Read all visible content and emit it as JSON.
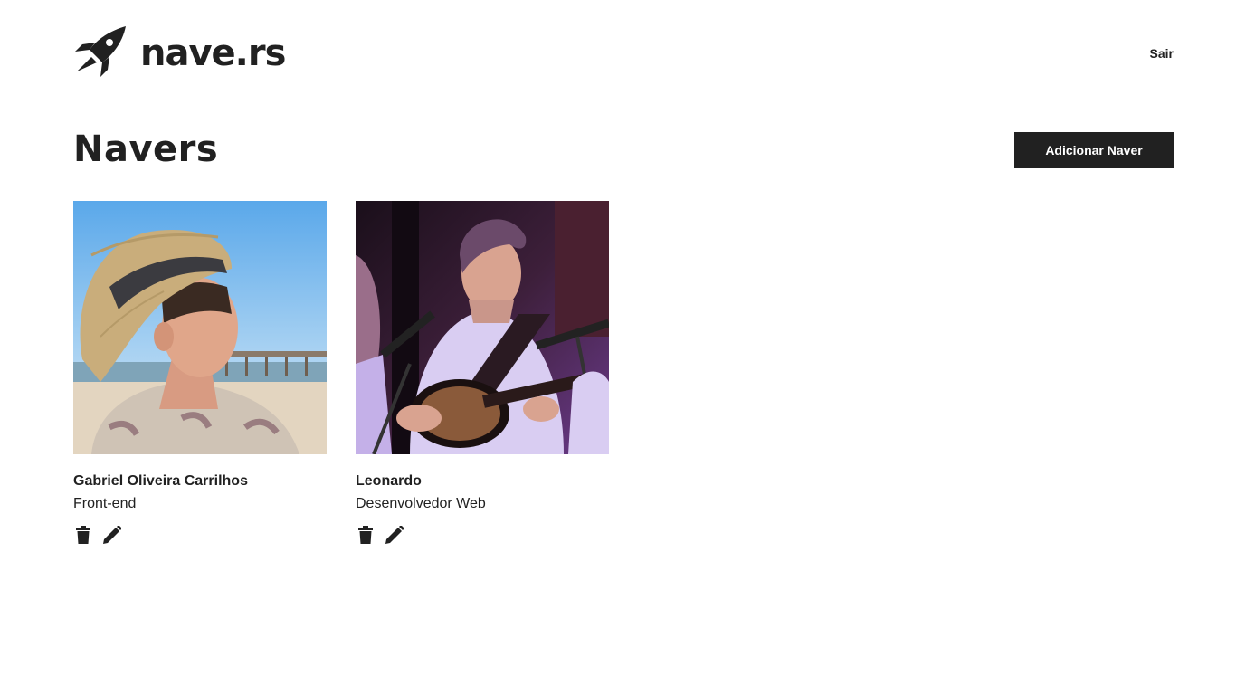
{
  "header": {
    "logo_text": "nave.rs",
    "logout_label": "Sair"
  },
  "main": {
    "title": "Navers",
    "add_button_label": "Adicionar Naver"
  },
  "navers": [
    {
      "name": "Gabriel Oliveira Carrilhos",
      "job_role": "Front-end"
    },
    {
      "name": "Leonardo",
      "job_role": "Desenvolvedor Web"
    }
  ],
  "colors": {
    "text": "#212121",
    "button_bg": "#212121",
    "button_text": "#ffffff",
    "background": "#ffffff"
  },
  "icons": {
    "logo": "rocket-icon",
    "delete": "trash-icon",
    "edit": "pencil-icon"
  }
}
